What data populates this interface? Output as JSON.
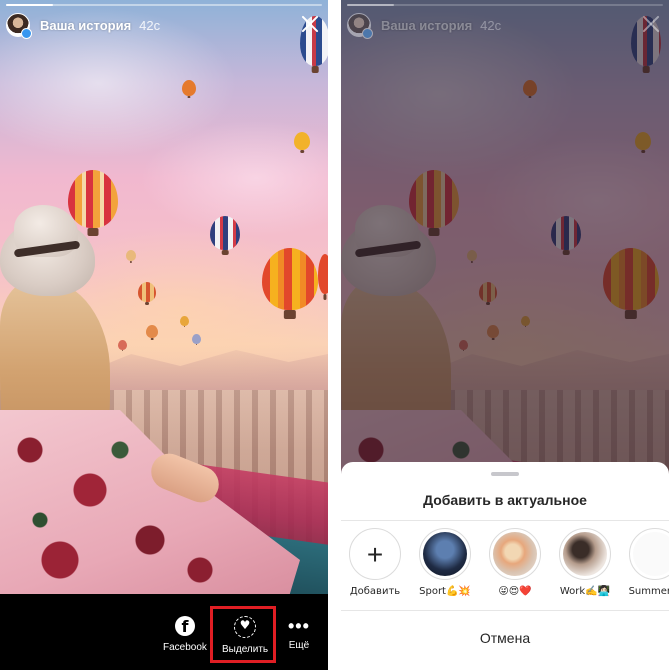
{
  "story": {
    "title": "Ваша история",
    "time": "42с",
    "progress": 0.15
  },
  "actions": {
    "facebook_label": "Facebook",
    "facebook_glyph": "f",
    "highlight_label": "Выделить",
    "more_label": "Ещё",
    "more_glyph": "•••"
  },
  "sheet": {
    "title": "Добавить в актуальное",
    "add_glyph": "+",
    "items": [
      {
        "label": "Добавить"
      },
      {
        "label": "Sport💪💥"
      },
      {
        "label": "😜😍❤️"
      },
      {
        "label": "Work✍️👩🏻‍💻"
      },
      {
        "label": "Summer😋"
      }
    ],
    "cancel": "Отмена"
  },
  "colors": {
    "highlight_box": "#e01e24",
    "avatar_badge": "#3897f0"
  }
}
